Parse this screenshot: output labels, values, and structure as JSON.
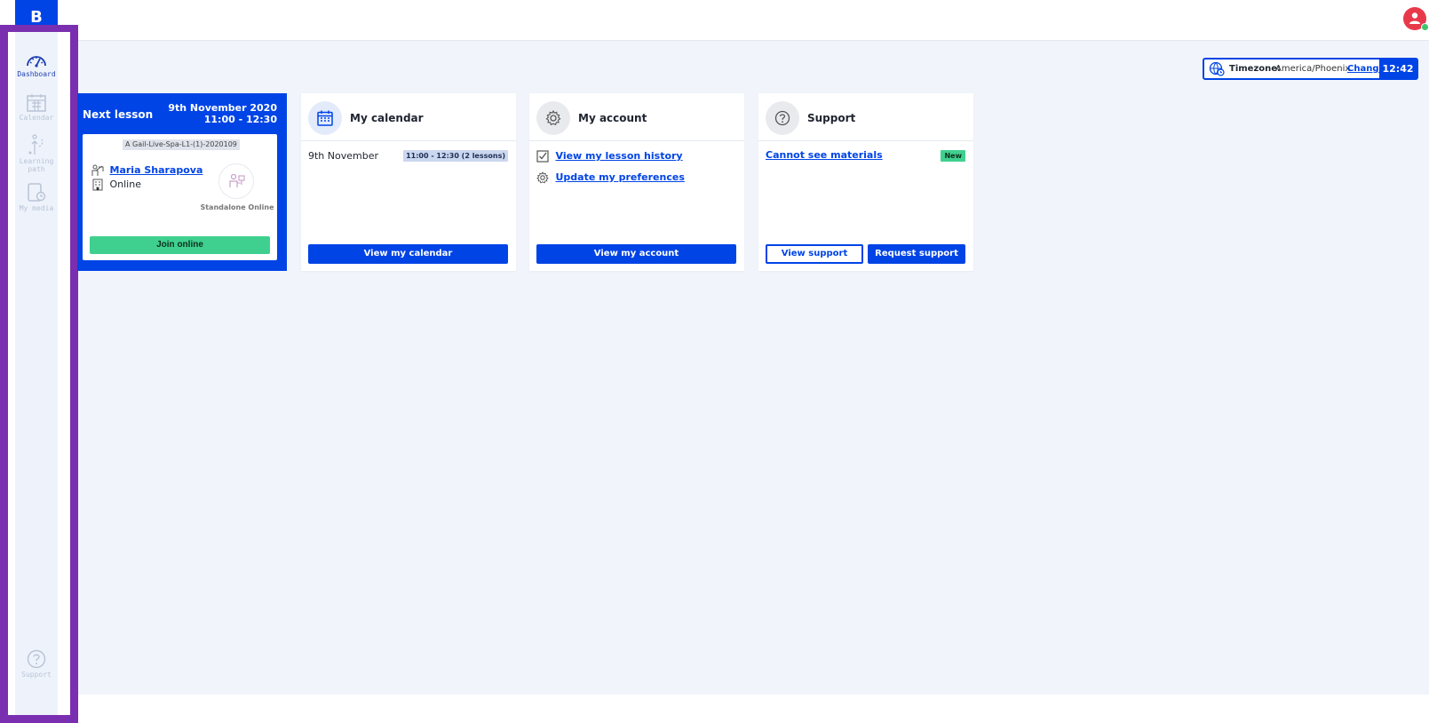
{
  "header": {
    "logo_text": "B",
    "user_avatar": "user-avatar-icon",
    "colors": {
      "brand": "#0044e6",
      "avatar": "#e8394b",
      "online": "#3ec46d",
      "success": "#3fd08f",
      "highlight_frame": "#7a2fb0"
    }
  },
  "sidebar": {
    "items": [
      {
        "label": "Dashboard",
        "icon": "gauge-icon",
        "state": "active"
      },
      {
        "label": "Calendar",
        "icon": "calendar-icon",
        "state": "disabled"
      },
      {
        "label": "Learning path",
        "icon": "path-icon",
        "state": "disabled"
      },
      {
        "label": "My media",
        "icon": "media-icon",
        "state": "disabled"
      }
    ],
    "support_label": "Support"
  },
  "timezone": {
    "label": "Timezone:",
    "value": "America/Phoenix",
    "change_label": "Change",
    "time": "12:42"
  },
  "next_lesson": {
    "title": "Next lesson",
    "date": "9th November 2020",
    "time": "11:00 - 12:30",
    "code": "A Gail-Live-Spa-L1-(1)-2020109",
    "teacher": "Maria Sharapova",
    "location": "Online",
    "type_label": "Standalone Online",
    "join_label": "Join online"
  },
  "calendar_card": {
    "title": "My calendar",
    "entry_date": "9th November",
    "entry_badge": "11:00 - 12:30 (2 lessons)",
    "button_label": "View my calendar"
  },
  "account_card": {
    "title": "My account",
    "link_history": "View my lesson history",
    "link_preferences": "Update my preferences",
    "button_label": "View my account"
  },
  "support_card": {
    "title": "Support",
    "link_materials": "Cannot see materials",
    "new_badge": "New",
    "view_button": "View support",
    "request_button": "Request support"
  }
}
